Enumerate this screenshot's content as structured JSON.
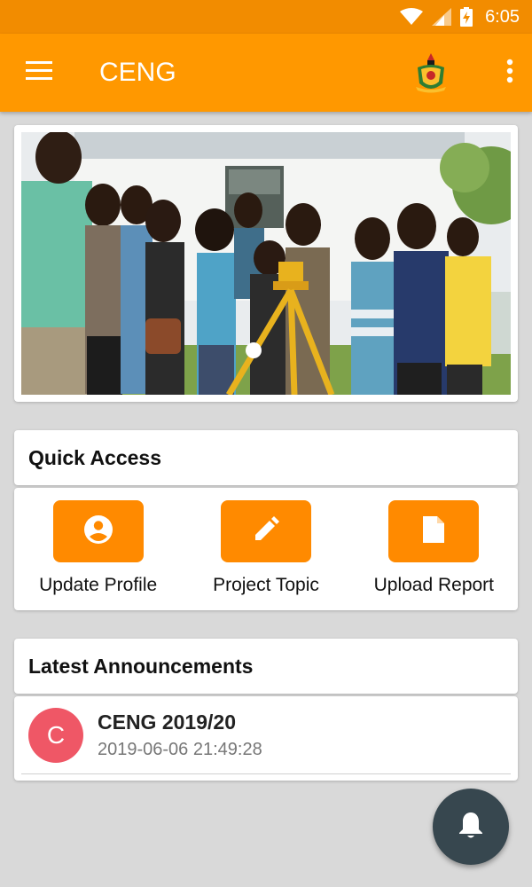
{
  "status_bar": {
    "time": "6:05",
    "icons": [
      "wifi-icon",
      "cell-signal-icon",
      "battery-charging-icon"
    ]
  },
  "app_bar": {
    "title": "CENG",
    "menu_icon": "hamburger-menu-icon",
    "logo": "university-crest-logo",
    "overflow_icon": "more-vert-icon"
  },
  "hero": {
    "image": "photo of students in field with surveying instrument"
  },
  "quick_access": {
    "title": "Quick Access",
    "items": [
      {
        "label": "Update Profile",
        "icon": "account-circle-icon"
      },
      {
        "label": "Project Topic",
        "icon": "pencil-icon"
      },
      {
        "label": "Upload Report",
        "icon": "document-icon"
      }
    ]
  },
  "announcements": {
    "title": "Latest Announcements",
    "items": [
      {
        "avatar_letter": "C",
        "title": "CENG 2019/20",
        "timestamp": "2019-06-06 21:49:28",
        "avatar_color": "#ef5766"
      }
    ]
  },
  "fab": {
    "icon": "bell-icon"
  },
  "colors": {
    "status_bar": "#f28c00",
    "app_bar": "#ff9800",
    "accent": "#ff8a00",
    "fab": "#37474f",
    "background": "#d9d9d9"
  }
}
